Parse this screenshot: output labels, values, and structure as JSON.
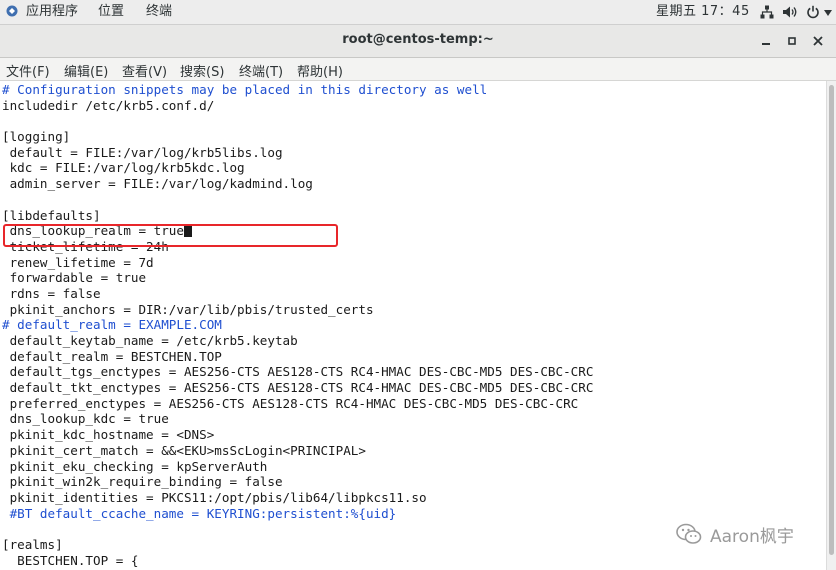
{
  "topbar": {
    "apps_label": "应用程序",
    "places_label": "位置",
    "terminal_label": "终端",
    "clock": "星期五 17：45",
    "icons": [
      "network-icon",
      "volume-icon",
      "power-icon",
      "chevron-down-icon"
    ]
  },
  "window": {
    "title": "root@centos-temp:~",
    "buttons": [
      "minimize-icon",
      "maximize-icon",
      "close-icon"
    ]
  },
  "menu": [
    {
      "name": "file",
      "label": "文件(F)"
    },
    {
      "name": "edit",
      "label": "编辑(E)"
    },
    {
      "name": "view",
      "label": "查看(V)"
    },
    {
      "name": "search",
      "label": "搜索(S)"
    },
    {
      "name": "terminal",
      "label": "终端(T)"
    },
    {
      "name": "help",
      "label": "帮助(H)"
    }
  ],
  "terminal": {
    "lines": [
      "# Configuration snippets may be placed in this directory as well",
      "includedir /etc/krb5.conf.d/",
      "",
      "[logging]",
      " default = FILE:/var/log/krb5libs.log",
      " kdc = FILE:/var/log/krb5kdc.log",
      " admin_server = FILE:/var/log/kadmind.log",
      "",
      "[libdefaults]",
      " dns_lookup_realm = true",
      " ticket_lifetime = 24h",
      " renew_lifetime = 7d",
      " forwardable = true",
      " rdns = false",
      " pkinit_anchors = DIR:/var/lib/pbis/trusted_certs",
      "# default_realm = EXAMPLE.COM",
      " default_keytab_name = /etc/krb5.keytab",
      " default_realm = BESTCHEN.TOP",
      " default_tgs_enctypes = AES256-CTS AES128-CTS RC4-HMAC DES-CBC-MD5 DES-CBC-CRC",
      " default_tkt_enctypes = AES256-CTS AES128-CTS RC4-HMAC DES-CBC-MD5 DES-CBC-CRC",
      " preferred_enctypes = AES256-CTS AES128-CTS RC4-HMAC DES-CBC-MD5 DES-CBC-CRC",
      " dns_lookup_kdc = true",
      " pkinit_kdc_hostname = <DNS>",
      " pkinit_cert_match = &&<EKU>msScLogin<PRINCIPAL>",
      " pkinit_eku_checking = kpServerAuth",
      " pkinit_win2k_require_binding = false",
      " pkinit_identities = PKCS11:/opt/pbis/lib64/libpkcs11.so",
      " #BT default_ccache_name = KEYRING:persistent:%{uid}",
      "",
      "[realms]",
      "  BESTCHEN.TOP = {"
    ],
    "comment_lines": [
      0,
      15,
      27
    ],
    "cursor_line": 9,
    "highlight_line": 9
  },
  "watermark": {
    "text": "Aaron枫宇"
  },
  "colors": {
    "comment": "#1f4fd0",
    "highlight_box": "#e8262a",
    "text": "#1a1a1a"
  }
}
